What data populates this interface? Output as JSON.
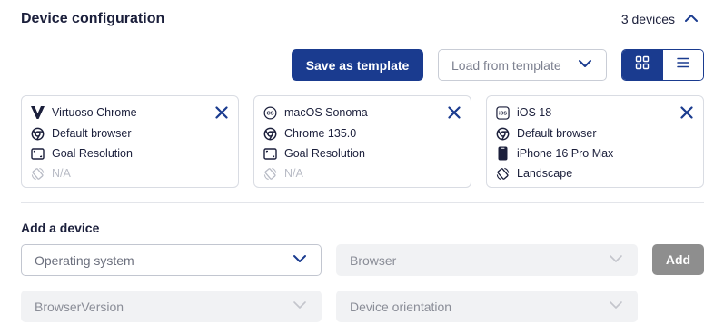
{
  "header": {
    "title": "Device configuration",
    "device_count": "3 devices",
    "collapse_icon": "chevron-up-icon"
  },
  "toolbar": {
    "save_template_label": "Save as template",
    "load_template_placeholder": "Load from template",
    "view_grid_icon": "grid-icon",
    "view_list_icon": "list-icon",
    "active_view": "grid"
  },
  "devices": [
    {
      "os": "Virtuoso Chrome",
      "browser": "Default browser",
      "resolution": "Goal Resolution",
      "orientation": "N/A",
      "orientation_muted": true
    },
    {
      "os": "macOS Sonoma",
      "browser": "Chrome 135.0",
      "resolution": "Goal Resolution",
      "orientation": "N/A",
      "orientation_muted": true
    },
    {
      "os": "iOS 18",
      "browser": "Default browser",
      "resolution": "iPhone 16 Pro Max",
      "orientation": "Landscape",
      "orientation_muted": false
    }
  ],
  "add_device": {
    "title": "Add a device",
    "os_placeholder": "Operating system",
    "browser_placeholder": "Browser",
    "browser_version_placeholder": "BrowserVersion",
    "orientation_placeholder": "Device orientation",
    "add_label": "Add"
  },
  "colors": {
    "primary": "#1a3b8f",
    "text": "#1b1f3b",
    "muted": "#b9bcc6",
    "disabled_bg": "#f1f2f4",
    "add_disabled": "#8e8e8e"
  }
}
